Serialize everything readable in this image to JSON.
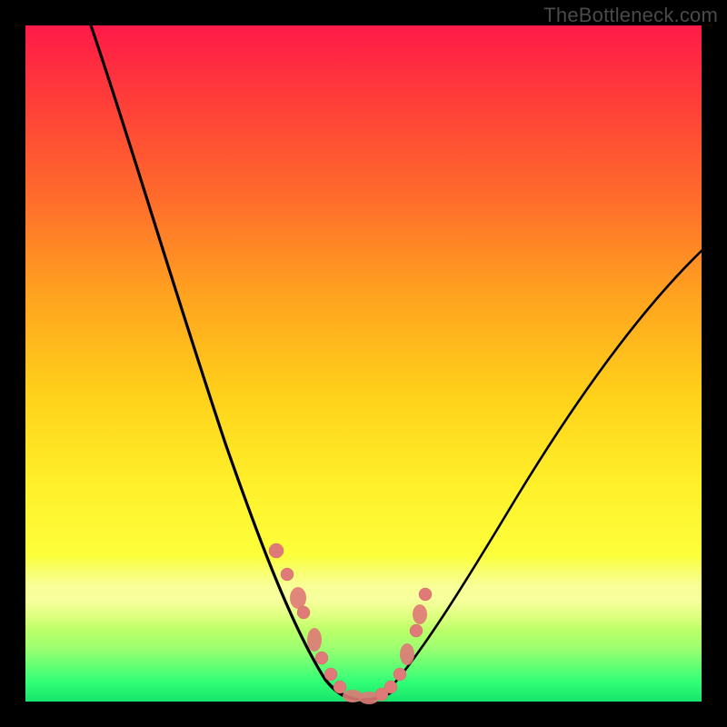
{
  "watermark": "TheBottleneck.com",
  "colors": {
    "gradient_top": "#ff1a49",
    "gradient_bottom": "#15e56a",
    "curve": "#000000",
    "dots": "#e07a78",
    "frame": "#000000"
  },
  "chart_data": {
    "type": "line",
    "title": "",
    "xlabel": "",
    "ylabel": "",
    "xlim": [
      0,
      100
    ],
    "ylim": [
      0,
      100
    ],
    "grid": false,
    "legend": false,
    "note": "Axes are unlabeled; values below are estimated fractions of the plot area (0 = left/bottom, 100 = right/top). The curve is a V-shaped bottleneck curve with its minimum near x≈48, y≈0.",
    "series": [
      {
        "name": "bottleneck-curve",
        "x": [
          10,
          15,
          20,
          25,
          30,
          35,
          38,
          41,
          44,
          46,
          48,
          50,
          53,
          56,
          60,
          65,
          70,
          80,
          90,
          100
        ],
        "y": [
          100,
          87,
          74,
          61,
          48,
          34,
          25,
          16,
          8,
          3,
          0,
          1,
          3,
          7,
          13,
          21,
          29,
          44,
          57,
          67
        ]
      }
    ],
    "marked_points": {
      "name": "highlight-dots",
      "note": "Salmon-colored markers clustered around the minimum of the curve.",
      "x": [
        37.0,
        38.8,
        40.2,
        41.0,
        42.8,
        44.0,
        45.3,
        46.5,
        48.0,
        49.5,
        51.0,
        52.3,
        53.5,
        55.0,
        56.7,
        57.1,
        57.6
      ],
      "y": [
        22.0,
        18.5,
        15.5,
        13.5,
        9.5,
        6.5,
        4.0,
        2.0,
        0.5,
        0.5,
        1.2,
        2.5,
        4.5,
        8.0,
        13.0,
        14.5,
        16.5
      ]
    }
  }
}
